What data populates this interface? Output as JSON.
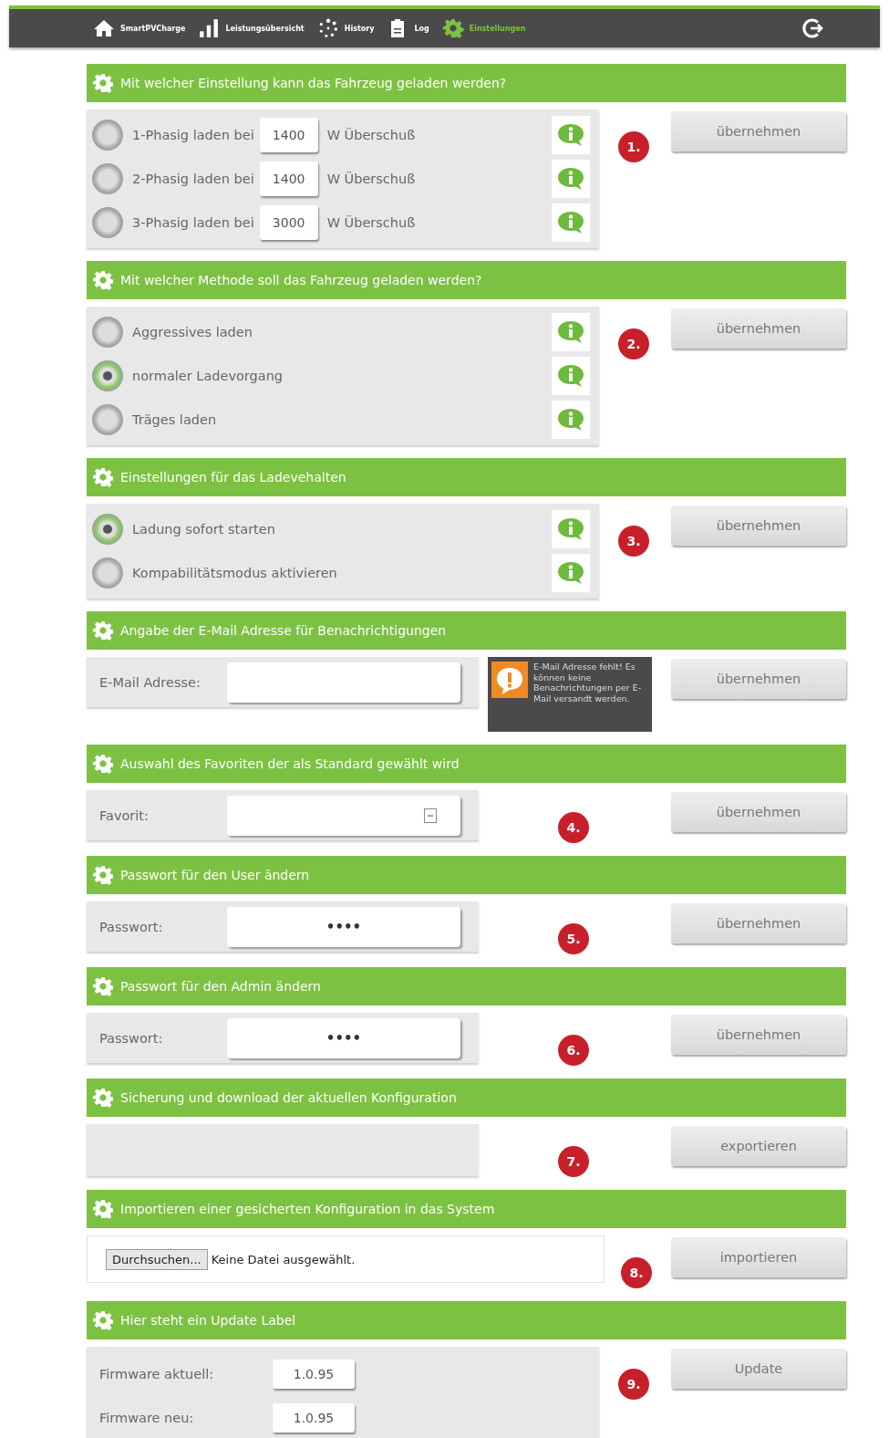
{
  "nav": {
    "items": [
      {
        "label": "SmartPVCharge",
        "selected": false
      },
      {
        "label": "Leistungsübersicht",
        "selected": false
      },
      {
        "label": "History",
        "selected": false
      },
      {
        "label": "Log",
        "selected": false
      },
      {
        "label": "Einstellungen",
        "selected": true
      }
    ]
  },
  "sections": [
    {
      "title": "Mit welcher Einstellung kann das Fahrzeug geladen werden?",
      "kind": "radios",
      "badge": "1.",
      "button": "übernehmen",
      "options": [
        {
          "label": "1-Phasig laden bei",
          "value": "1400",
          "suffix": "W Überschuß",
          "selected": false
        },
        {
          "label": "2-Phasig laden bei",
          "value": "1400",
          "suffix": "W Überschuß",
          "selected": false
        },
        {
          "label": "3-Phasig laden bei",
          "value": "3000",
          "suffix": "W Überschuß",
          "selected": false
        }
      ]
    },
    {
      "title": "Mit welcher Methode soll das Fahrzeug geladen werden?",
      "kind": "radios",
      "badge": "2.",
      "button": "übernehmen",
      "options": [
        {
          "label": "Aggressives laden",
          "selected": false
        },
        {
          "label": "normaler Ladevorgang",
          "selected": true
        },
        {
          "label": "Träges laden",
          "selected": false
        }
      ]
    },
    {
      "title": "Einstellungen für das Ladevehalten",
      "kind": "radios",
      "badge": "3.",
      "button": "übernehmen",
      "options": [
        {
          "label": "Ladung sofort starten",
          "selected": true
        },
        {
          "label": "Kompabilitätsmodus aktivieren",
          "selected": false
        }
      ]
    },
    {
      "title": "Angabe der E-Mail Adresse für Benachrichtigungen",
      "kind": "field",
      "label": "E-Mail Adresse:",
      "dropdown": false,
      "warning": "E-Mail Adresse fehlt! Es können keine Benachrichtungen per E-Mail versandt werden.",
      "button": "übernehmen"
    },
    {
      "title": "Auswahl des Favoriten der als Standard gewählt wird",
      "kind": "field",
      "label": "Favorit:",
      "dropdown": true,
      "badge": "4.",
      "button": "übernehmen"
    },
    {
      "title": "Passwort für den User ändern",
      "kind": "field",
      "label": "Passwort:",
      "dropdown": false,
      "value": "••••",
      "badge": "5.",
      "button": "übernehmen"
    },
    {
      "title": "Passwort für den Admin ändern",
      "kind": "field",
      "label": "Passwort:",
      "dropdown": false,
      "value": "••••",
      "badge": "6.",
      "button": "übernehmen"
    },
    {
      "title": "Sicherung und download der aktuellen Konfiguration",
      "kind": "empty",
      "badge": "7.",
      "button": "exportieren"
    },
    {
      "title": "Importieren einer gesicherten Konfiguration in das System",
      "kind": "file",
      "browse": "Durchsuchen...",
      "status": "Keine Datei ausgewählt.",
      "badge": "8.",
      "button": "importieren"
    },
    {
      "title": "Hier steht ein Update Label",
      "kind": "firmware",
      "rows": [
        {
          "label": "Firmware aktuell:",
          "value": "1.0.95"
        },
        {
          "label": "Firmware neu:",
          "value": "1.0.95"
        }
      ],
      "badge": "9.",
      "button": "Update"
    }
  ]
}
